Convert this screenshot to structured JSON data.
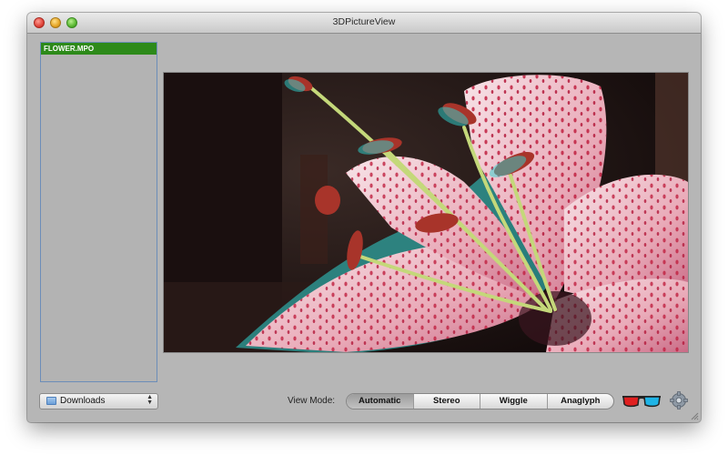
{
  "window": {
    "title": "3DPictureView"
  },
  "sidebar": {
    "files": [
      {
        "name": "FLOWER.MPO",
        "selected": true
      }
    ],
    "folder_popup": {
      "value": "Downloads",
      "icon": "folder-icon"
    }
  },
  "toolbar": {
    "view_mode_label": "View Mode:",
    "view_modes": [
      {
        "label": "Automatic",
        "selected": true
      },
      {
        "label": "Stereo",
        "selected": false
      },
      {
        "label": "Wiggle",
        "selected": false
      },
      {
        "label": "Anaglyph",
        "selected": false
      }
    ],
    "glasses_icon": "anaglyph-glasses-icon",
    "settings_icon": "gear-icon"
  },
  "colors": {
    "selection": "#2d8a1a",
    "window_bg": "#b6b6b6",
    "sidebar_border": "#6c8db8"
  }
}
